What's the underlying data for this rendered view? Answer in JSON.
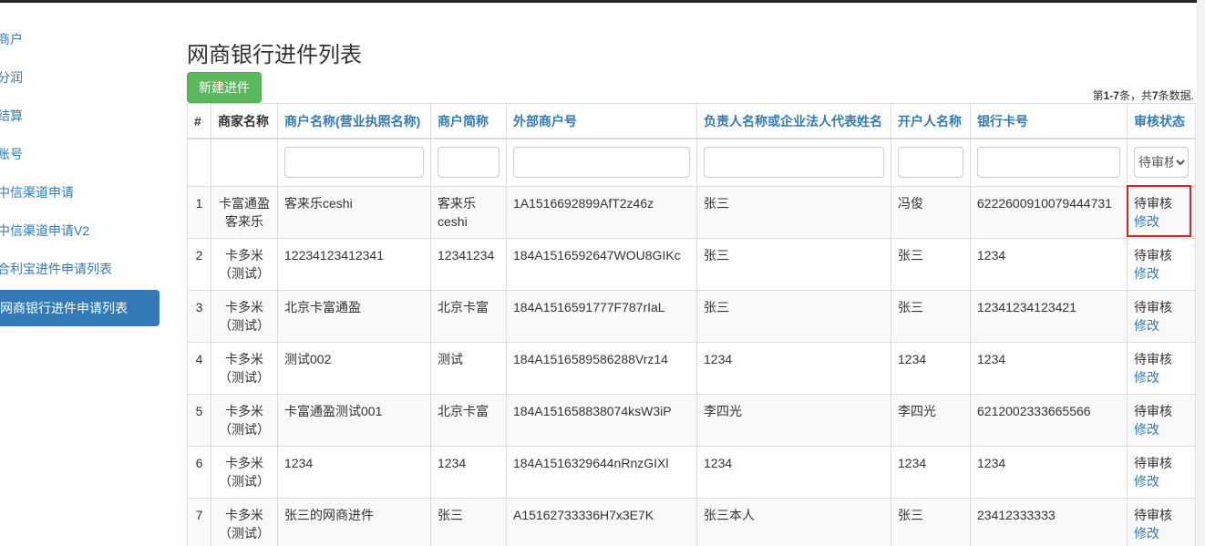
{
  "sidebar": {
    "items": [
      {
        "label": "商户"
      },
      {
        "label": "分润"
      },
      {
        "label": "结算"
      },
      {
        "label": "账号"
      },
      {
        "label": "中信渠道申请"
      },
      {
        "label": "中信渠道申请V2"
      },
      {
        "label": "合利宝进件申请列表"
      },
      {
        "label": "网商银行进件申请列表"
      }
    ]
  },
  "page": {
    "title": "网商银行进件列表",
    "new_button": "新建进件",
    "summary_prefix": "第",
    "summary_range": "1-7",
    "summary_middle": "条，共",
    "summary_total": "7",
    "summary_suffix": "条数据."
  },
  "table": {
    "headers": {
      "num": "#",
      "merchant": "商家名称",
      "name": "商户名称(营业执照名称)",
      "short": "商户简称",
      "external": "外部商户号",
      "person": "负责人名称或企业法人代表姓名",
      "holder": "开户人名称",
      "card": "银行卡号",
      "status": "审核状态"
    },
    "status_filter_selected": "待审核",
    "rows": [
      {
        "num": "1",
        "merchant": "卡富通盈 客来乐",
        "name": "客来乐ceshi",
        "short": "客来乐ceshi",
        "external": "1A1516692899AfT2z46z",
        "person": "张三",
        "holder": "冯俊",
        "card": "6222600910079444731",
        "status": "待审核",
        "action": "修改"
      },
      {
        "num": "2",
        "merchant": "卡多米（测试）",
        "name": "12234123412341",
        "short": "12341234",
        "external": "184A1516592647WOU8GIKc",
        "person": "张三",
        "holder": "张三",
        "card": "1234",
        "status": "待审核",
        "action": "修改"
      },
      {
        "num": "3",
        "merchant": "卡多米（测试）",
        "name": "北京卡富通盈",
        "short": "北京卡富",
        "external": "184A1516591777F787rIaL",
        "person": "张三",
        "holder": "张三",
        "card": "12341234123421",
        "status": "待审核",
        "action": "修改"
      },
      {
        "num": "4",
        "merchant": "卡多米（测试）",
        "name": "测试002",
        "short": "测试",
        "external": "184A1516589586288Vrz14",
        "person": "1234",
        "holder": "1234",
        "card": "1234",
        "status": "待审核",
        "action": "修改"
      },
      {
        "num": "5",
        "merchant": "卡多米（测试）",
        "name": "卡富通盈测试001",
        "short": "北京卡富",
        "external": "184A151658838074ksW3iP",
        "person": "李四光",
        "holder": "李四光",
        "card": "6212002333665566",
        "status": "待审核",
        "action": "修改"
      },
      {
        "num": "6",
        "merchant": "卡多米（测试）",
        "name": "1234",
        "short": "1234",
        "external": "184A1516329644nRnzGIXl",
        "person": "1234",
        "holder": "1234",
        "card": "1234",
        "status": "待审核",
        "action": "修改"
      },
      {
        "num": "7",
        "merchant": "卡多米（测试）",
        "name": "张三的网商进件",
        "short": "张三",
        "external": "A15162733336H7x3E7K",
        "person": "张三本人",
        "holder": "张三",
        "card": "23412333333",
        "status": "待审核",
        "action": "修改"
      }
    ]
  },
  "colors": {
    "accent": "#337ab7",
    "button_green": "#5cb85c",
    "highlight_red": "#e12020"
  }
}
